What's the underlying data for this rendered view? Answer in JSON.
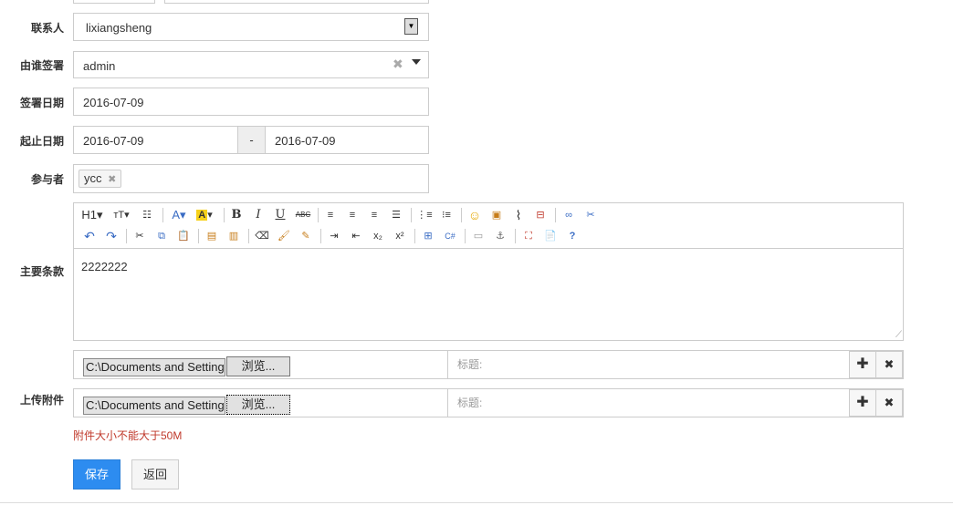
{
  "labels": {
    "contact": "联系人",
    "signer": "由谁签署",
    "sign_date": "签署日期",
    "period": "起止日期",
    "participants": "参与者",
    "main_terms": "主要条款",
    "upload": "上传附件"
  },
  "fields": {
    "contact_value": "lixiangsheng",
    "signer_value": "admin",
    "sign_date_value": "2016-07-09",
    "start_date_value": "2016-07-09",
    "date_sep": "-",
    "end_date_value": "2016-07-09",
    "participant_tag": "ycc"
  },
  "editor": {
    "content": "2222222",
    "toolbar_row1": [
      "H1",
      "T",
      "|||",
      "A",
      "A",
      "B",
      "I",
      "U",
      "ABC"
    ],
    "toolbar_row2": [
      "x₂",
      "x²"
    ]
  },
  "attachments": [
    {
      "path": "C:\\Documents and Settings",
      "browse_label": "浏览...",
      "title_placeholder": "标题:"
    },
    {
      "path": "C:\\Documents and Settings",
      "browse_label": "浏览...",
      "title_placeholder": "标题:"
    }
  ],
  "attach_note": "附件大小不能大于50M",
  "buttons": {
    "save": "保存",
    "back": "返回"
  },
  "colors": {
    "primary": "#2d8cf0",
    "note": "#c0392b"
  }
}
